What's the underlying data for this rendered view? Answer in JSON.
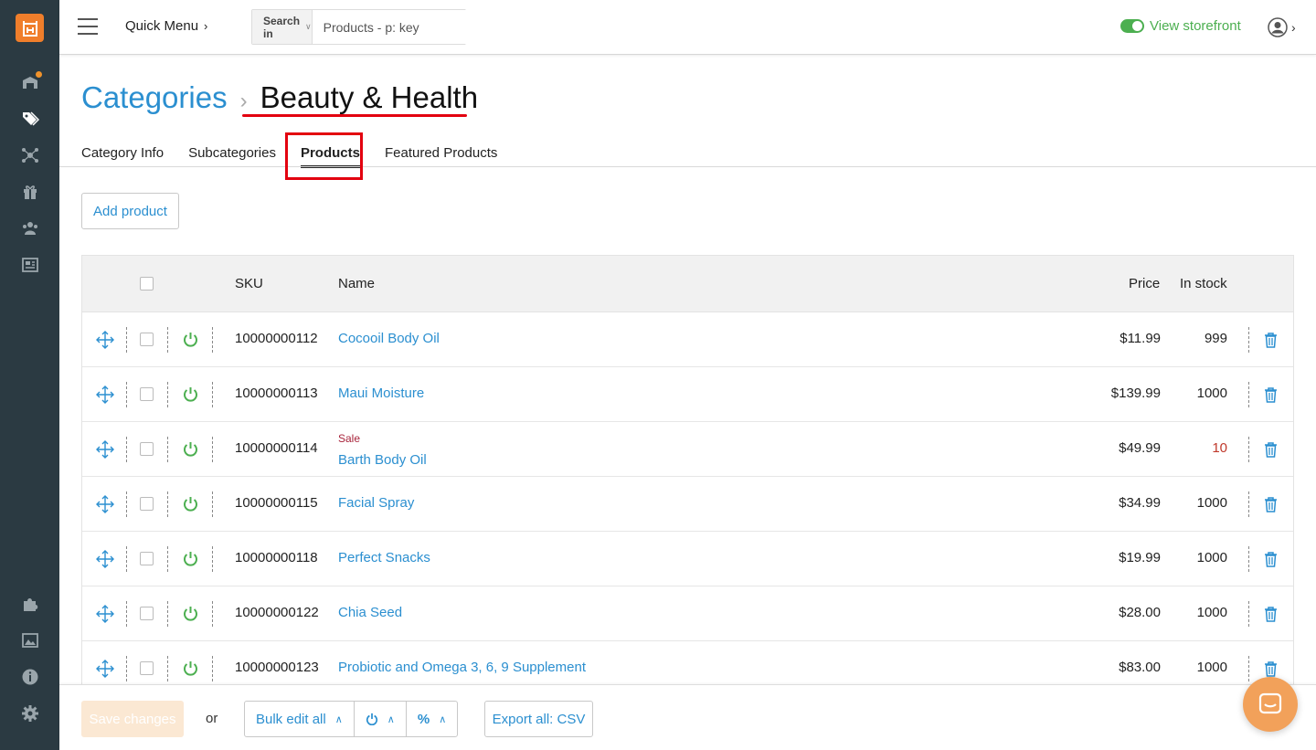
{
  "topbar": {
    "quick_menu": "Quick Menu",
    "search_in_label": "Search in",
    "search_placeholder": "Products - p: key",
    "storefront_label": "View storefront"
  },
  "breadcrumb": {
    "parent": "Categories",
    "current": "Beauty & Health"
  },
  "tabs": [
    {
      "label": "Category Info",
      "active": false
    },
    {
      "label": "Subcategories",
      "active": false
    },
    {
      "label": "Products",
      "active": true
    },
    {
      "label": "Featured Products",
      "active": false
    }
  ],
  "add_product_label": "Add product",
  "table": {
    "columns": {
      "sku": "SKU",
      "name": "Name",
      "price": "Price",
      "stock": "In stock"
    },
    "rows": [
      {
        "sku": "10000000112",
        "name": "Cocooil Body Oil",
        "price": "$11.99",
        "stock": "999",
        "sale": "",
        "low_stock": false
      },
      {
        "sku": "10000000113",
        "name": "Maui Moisture",
        "price": "$139.99",
        "stock": "1000",
        "sale": "",
        "low_stock": false
      },
      {
        "sku": "10000000114",
        "name": "Barth Body Oil",
        "price": "$49.99",
        "stock": "10",
        "sale": "Sale",
        "low_stock": true
      },
      {
        "sku": "10000000115",
        "name": "Facial Spray",
        "price": "$34.99",
        "stock": "1000",
        "sale": "",
        "low_stock": false
      },
      {
        "sku": "10000000118",
        "name": "Perfect Snacks",
        "price": "$19.99",
        "stock": "1000",
        "sale": "",
        "low_stock": false
      },
      {
        "sku": "10000000122",
        "name": "Chia Seed",
        "price": "$28.00",
        "stock": "1000",
        "sale": "",
        "low_stock": false
      },
      {
        "sku": "10000000123",
        "name": "Probiotic and Omega 3, 6, 9 Supplement",
        "price": "$83.00",
        "stock": "1000",
        "sale": "",
        "low_stock": false
      }
    ]
  },
  "footer": {
    "save_label": "Save changes",
    "or_label": "or",
    "bulk_edit_label": "Bulk edit all",
    "export_label": "Export all: CSV"
  },
  "colors": {
    "accent": "#2b8fd0",
    "sidebar": "#2b3a42",
    "brand": "#f07e2b",
    "success": "#4caf50",
    "highlight": "#e3000f"
  },
  "icons": {
    "sidebar": [
      "orders-icon",
      "catalog-tags-icon",
      "network-icon",
      "gift-icon",
      "users-icon",
      "content-icon",
      "modules-puzzle-icon",
      "images-icon",
      "info-icon",
      "settings-gear-icon"
    ]
  }
}
